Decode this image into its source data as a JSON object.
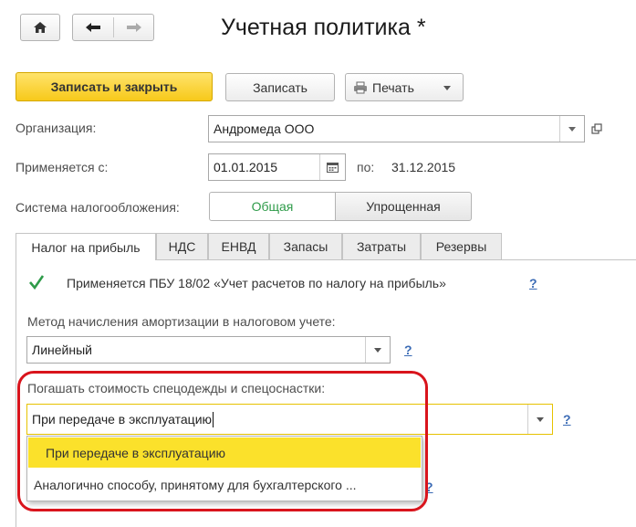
{
  "window": {
    "title": "Учетная политика *"
  },
  "nav": {
    "home_icon": "home-icon",
    "back_icon": "arrow-left-icon",
    "forward_icon": "arrow-right-icon"
  },
  "toolbar": {
    "save_close_label": "Записать и закрыть",
    "save_label": "Записать",
    "print_label": "Печать"
  },
  "form": {
    "organization_label": "Организация:",
    "organization_value": "Андромеда ООО",
    "applies_from_label": "Применяется с:",
    "applies_from_value": "01.01.2015",
    "applies_to_label": "по:",
    "applies_to_value": "31.12.2015",
    "tax_system_label": "Система налогообложения:",
    "tax_system_options": [
      "Общая",
      "Упрощенная"
    ],
    "tax_system_selected": "Общая"
  },
  "tabs": [
    {
      "label": "Налог на прибыль"
    },
    {
      "label": "НДС"
    },
    {
      "label": "ЕНВД"
    },
    {
      "label": "Запасы"
    },
    {
      "label": "Затраты"
    },
    {
      "label": "Резервы"
    }
  ],
  "profit_tab": {
    "pbu_checkbox_label": "Применяется ПБУ 18/02 «Учет расчетов по налогу на прибыль»",
    "pbu_checked": true,
    "amort_label": "Метод начисления амортизации в налоговом учете:",
    "amort_value": "Линейный",
    "workwear_label": "Погашать стоимость спецодежды и спецоснастки:",
    "workwear_value": "При передаче в эксплуатацию",
    "workwear_options": [
      "При передаче в эксплуатацию",
      "Аналогично способу, принятому для бухгалтерского ..."
    ],
    "help_label": "?"
  },
  "colors": {
    "accent": "#f7c91a",
    "highlight": "#fbe12b",
    "green": "#2e9b49",
    "annotation": "#d9141c"
  }
}
